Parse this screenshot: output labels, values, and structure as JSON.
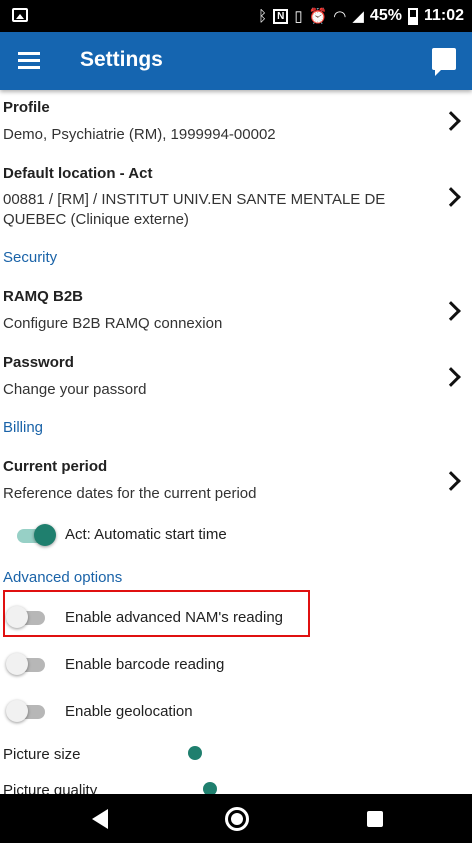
{
  "status_bar": {
    "battery_text": "45%",
    "time": "11:02",
    "icons": [
      "gallery-icon",
      "bluetooth-icon",
      "nfc-icon",
      "vibrate-icon",
      "alarm-icon",
      "wifi-icon",
      "signal-icon",
      "battery-icon"
    ]
  },
  "app_bar": {
    "title": "Settings",
    "menu_icon": "hamburger-menu-icon",
    "action_icon": "chat-icon",
    "color": "#1565b0"
  },
  "profile": {
    "title": "Profile",
    "subtitle": "Demo, Psychiatrie (RM), 1999994-00002"
  },
  "default_location": {
    "title": "Default location - Act",
    "subtitle": "00881 / [RM] / INSTITUT UNIV.EN SANTE MENTALE DE QUEBEC (Clinique externe)"
  },
  "security": {
    "section_label": "Security",
    "ramq": {
      "title": "RAMQ B2B",
      "subtitle": "Configure B2B RAMQ connexion"
    },
    "password": {
      "title": "Password",
      "subtitle": "Change your passord"
    }
  },
  "billing": {
    "section_label": "Billing",
    "current_period": {
      "title": "Current period",
      "subtitle": "Reference dates for the current period"
    },
    "auto_start": {
      "label": "Act: Automatic start time",
      "checked": true
    }
  },
  "advanced": {
    "section_label": "Advanced options",
    "nam_reading": {
      "label": "Enable advanced NAM's reading",
      "checked": false
    },
    "barcode_reading": {
      "label": "Enable barcode reading",
      "checked": false
    },
    "geolocation": {
      "label": "Enable geolocation",
      "checked": false
    },
    "picture_size": {
      "label": "Picture size"
    },
    "picture_quality": {
      "label": "Picture quality"
    }
  },
  "colors": {
    "accent": "#1f7f6e",
    "section": "#1a63a8",
    "highlight": "#e01010"
  }
}
